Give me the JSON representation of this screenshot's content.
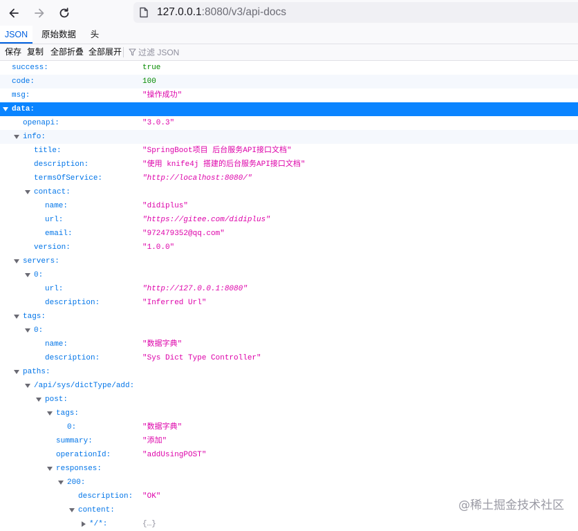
{
  "browser": {
    "url_host": "127.0.0.1",
    "url_rest": ":8080/v3/api-docs"
  },
  "tabs": [
    {
      "label": "JSON"
    },
    {
      "label": "原始数据"
    },
    {
      "label": "头"
    }
  ],
  "toolbar": {
    "save": "保存",
    "copy": "复制",
    "collapse_all": "全部折叠",
    "expand_all": "全部展开",
    "filter_placeholder": "过滤 JSON"
  },
  "rows": [
    {
      "key": "success:",
      "value": "true"
    },
    {
      "key": "code:",
      "value": "100"
    },
    {
      "key": "msg:",
      "value": "\"操作成功\""
    },
    {
      "key": "data:",
      "value": ""
    },
    {
      "key": "openapi:",
      "value": "\"3.0.3\""
    },
    {
      "key": "info:",
      "value": ""
    },
    {
      "key": "title:",
      "value": "\"SpringBoot项目 后台服务API接口文档\""
    },
    {
      "key": "description:",
      "value": "\"使用 knife4j 搭建的后台服务API接口文档\""
    },
    {
      "key": "termsOfService:",
      "value": "\"http://localhost:8080/\""
    },
    {
      "key": "contact:",
      "value": ""
    },
    {
      "key": "name:",
      "value": "\"didiplus\""
    },
    {
      "key": "url:",
      "value": "\"https://gitee.com/didiplus\""
    },
    {
      "key": "email:",
      "value": "\"972479352@qq.com\""
    },
    {
      "key": "version:",
      "value": "\"1.0.0\""
    },
    {
      "key": "servers:",
      "value": ""
    },
    {
      "key": "0:",
      "value": ""
    },
    {
      "key": "url:",
      "value": "\"http://127.0.0.1:8080\""
    },
    {
      "key": "description:",
      "value": "\"Inferred Url\""
    },
    {
      "key": "tags:",
      "value": ""
    },
    {
      "key": "0:",
      "value": ""
    },
    {
      "key": "name:",
      "value": "\"数据字典\""
    },
    {
      "key": "description:",
      "value": "\"Sys Dict Type Controller\""
    },
    {
      "key": "paths:",
      "value": ""
    },
    {
      "key": "/api/sys/dictType/add:",
      "value": ""
    },
    {
      "key": "post:",
      "value": ""
    },
    {
      "key": "tags:",
      "value": ""
    },
    {
      "key": "0:",
      "value": "\"数据字典\""
    },
    {
      "key": "summary:",
      "value": "\"添加\""
    },
    {
      "key": "operationId:",
      "value": "\"addUsingPOST\""
    },
    {
      "key": "responses:",
      "value": ""
    },
    {
      "key": "200:",
      "value": ""
    },
    {
      "key": "description:",
      "value": "\"OK\""
    },
    {
      "key": "content:",
      "value": ""
    },
    {
      "key": "*/*:",
      "value": "{…}"
    }
  ],
  "watermark": "@稀土掘金技术社区"
}
